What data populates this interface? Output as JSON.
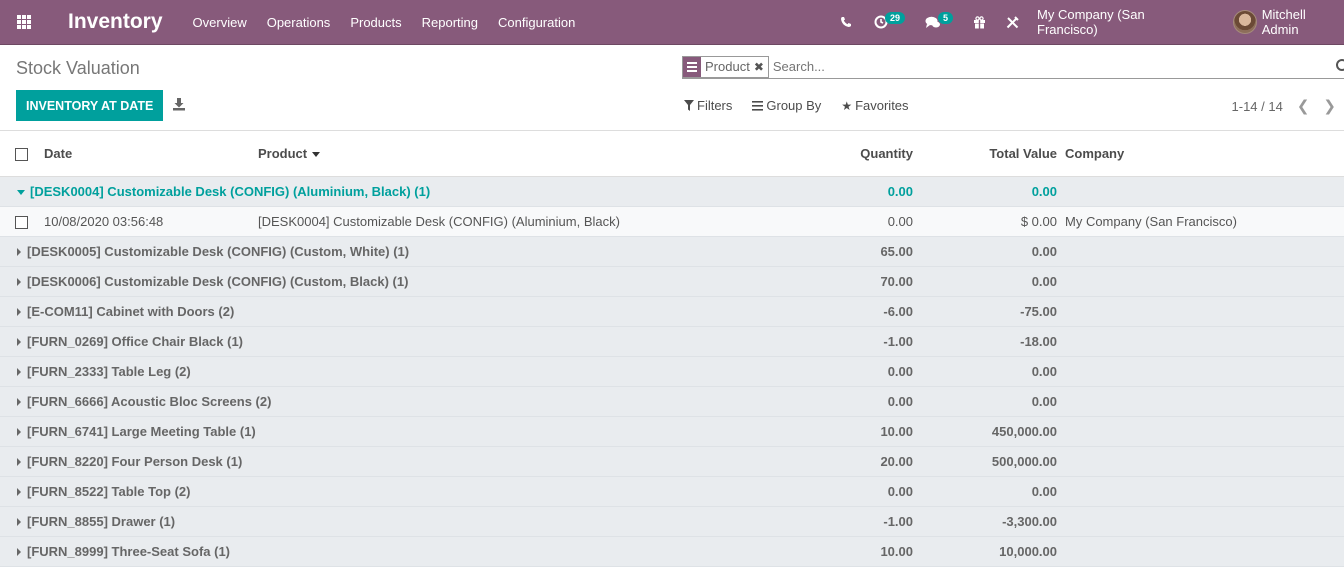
{
  "navbar": {
    "app_name": "Inventory",
    "menu": [
      "Overview",
      "Operations",
      "Products",
      "Reporting",
      "Configuration"
    ],
    "activity_count": "29",
    "message_count": "5",
    "company": "My Company (San Francisco)",
    "user": "Mitchell Admin"
  },
  "control": {
    "title": "Stock Valuation",
    "primary_button": "INVENTORY AT DATE",
    "search": {
      "facet_value": "Product",
      "placeholder": "Search..."
    },
    "filters_label": "Filters",
    "group_by_label": "Group By",
    "favorites_label": "Favorites",
    "pager": "1-14 / 14"
  },
  "colors": {
    "brand": "#875a7b",
    "accent": "#00a09d"
  },
  "table": {
    "columns": {
      "date": "Date",
      "product": "Product",
      "quantity": "Quantity",
      "total_value": "Total Value",
      "company": "Company"
    },
    "open_group": {
      "label": "[DESK0004] Customizable Desk (CONFIG) (Aluminium, Black) (1)",
      "quantity": "0.00",
      "total_value": "0.00",
      "record": {
        "date": "10/08/2020 03:56:48",
        "product": "[DESK0004] Customizable Desk (CONFIG) (Aluminium, Black)",
        "quantity": "0.00",
        "total_value": "$ 0.00",
        "company": "My Company (San Francisco)"
      }
    },
    "groups": [
      {
        "label": "[DESK0005] Customizable Desk (CONFIG) (Custom, White) (1)",
        "quantity": "65.00",
        "total_value": "0.00"
      },
      {
        "label": "[DESK0006] Customizable Desk (CONFIG) (Custom, Black) (1)",
        "quantity": "70.00",
        "total_value": "0.00"
      },
      {
        "label": "[E-COM11] Cabinet with Doors (2)",
        "quantity": "-6.00",
        "total_value": "-75.00"
      },
      {
        "label": "[FURN_0269] Office Chair Black (1)",
        "quantity": "-1.00",
        "total_value": "-18.00"
      },
      {
        "label": "[FURN_2333] Table Leg (2)",
        "quantity": "0.00",
        "total_value": "0.00"
      },
      {
        "label": "[FURN_6666] Acoustic Bloc Screens (2)",
        "quantity": "0.00",
        "total_value": "0.00"
      },
      {
        "label": "[FURN_6741] Large Meeting Table (1)",
        "quantity": "10.00",
        "total_value": "450,000.00"
      },
      {
        "label": "[FURN_8220] Four Person Desk (1)",
        "quantity": "20.00",
        "total_value": "500,000.00"
      },
      {
        "label": "[FURN_8522] Table Top (2)",
        "quantity": "0.00",
        "total_value": "0.00"
      },
      {
        "label": "[FURN_8855] Drawer (1)",
        "quantity": "-1.00",
        "total_value": "-3,300.00"
      },
      {
        "label": "[FURN_8999] Three-Seat Sofa (1)",
        "quantity": "10.00",
        "total_value": "10,000.00"
      }
    ]
  }
}
